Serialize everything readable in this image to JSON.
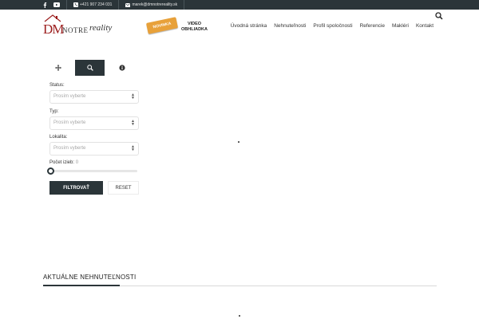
{
  "topbar": {
    "phone": "+421 907 234 031",
    "email": "marek@dmnotrereality.sk",
    "icons": [
      "facebook-icon",
      "youtube-icon",
      "phone-icon",
      "mail-icon"
    ]
  },
  "logo": {
    "dm": "DM",
    "notre": "NOTRE",
    "reality": "reality"
  },
  "promo": {
    "tag": "NOVINKA",
    "line1": "VIDEO",
    "line2": "OBHLIADKA"
  },
  "nav": {
    "items": [
      "Úvodná stránka",
      "Nehnuteľnosti",
      "Profil spoločnosti",
      "Referencie",
      "Makléri",
      "Kontakt"
    ]
  },
  "filters": {
    "status_label": "Status:",
    "status_placeholder": "Prosím vyberte",
    "type_label": "Typ:",
    "type_placeholder": "Prosím vyberte",
    "location_label": "Lokalita:",
    "location_placeholder": "Prosím vyberte",
    "rooms_label": "Počet izieb:",
    "rooms_value": "0",
    "filter_button": "FILTROVAŤ",
    "reset_button": "RESET"
  },
  "section": {
    "title": "AKTUÁLNE NEHNUTEĽNOSTI"
  },
  "colors": {
    "dark": "#2b3539",
    "brand_red": "#9b1c1c",
    "promo_orange": "#e8a13a"
  }
}
